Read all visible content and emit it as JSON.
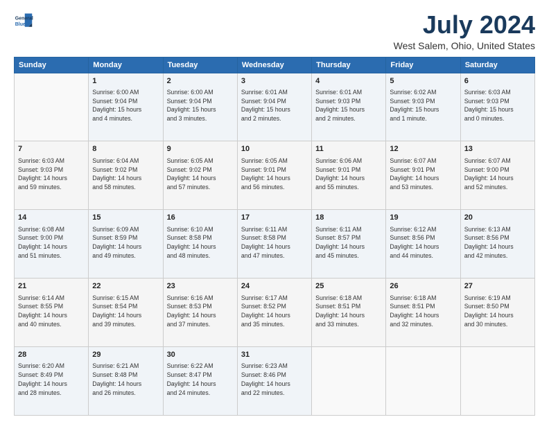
{
  "logo": {
    "line1": "General",
    "line2": "Blue"
  },
  "title": "July 2024",
  "subtitle": "West Salem, Ohio, United States",
  "weekdays": [
    "Sunday",
    "Monday",
    "Tuesday",
    "Wednesday",
    "Thursday",
    "Friday",
    "Saturday"
  ],
  "weeks": [
    [
      {
        "num": "",
        "info": ""
      },
      {
        "num": "1",
        "info": "Sunrise: 6:00 AM\nSunset: 9:04 PM\nDaylight: 15 hours\nand 4 minutes."
      },
      {
        "num": "2",
        "info": "Sunrise: 6:00 AM\nSunset: 9:04 PM\nDaylight: 15 hours\nand 3 minutes."
      },
      {
        "num": "3",
        "info": "Sunrise: 6:01 AM\nSunset: 9:04 PM\nDaylight: 15 hours\nand 2 minutes."
      },
      {
        "num": "4",
        "info": "Sunrise: 6:01 AM\nSunset: 9:03 PM\nDaylight: 15 hours\nand 2 minutes."
      },
      {
        "num": "5",
        "info": "Sunrise: 6:02 AM\nSunset: 9:03 PM\nDaylight: 15 hours\nand 1 minute."
      },
      {
        "num": "6",
        "info": "Sunrise: 6:03 AM\nSunset: 9:03 PM\nDaylight: 15 hours\nand 0 minutes."
      }
    ],
    [
      {
        "num": "7",
        "info": "Sunrise: 6:03 AM\nSunset: 9:03 PM\nDaylight: 14 hours\nand 59 minutes."
      },
      {
        "num": "8",
        "info": "Sunrise: 6:04 AM\nSunset: 9:02 PM\nDaylight: 14 hours\nand 58 minutes."
      },
      {
        "num": "9",
        "info": "Sunrise: 6:05 AM\nSunset: 9:02 PM\nDaylight: 14 hours\nand 57 minutes."
      },
      {
        "num": "10",
        "info": "Sunrise: 6:05 AM\nSunset: 9:01 PM\nDaylight: 14 hours\nand 56 minutes."
      },
      {
        "num": "11",
        "info": "Sunrise: 6:06 AM\nSunset: 9:01 PM\nDaylight: 14 hours\nand 55 minutes."
      },
      {
        "num": "12",
        "info": "Sunrise: 6:07 AM\nSunset: 9:01 PM\nDaylight: 14 hours\nand 53 minutes."
      },
      {
        "num": "13",
        "info": "Sunrise: 6:07 AM\nSunset: 9:00 PM\nDaylight: 14 hours\nand 52 minutes."
      }
    ],
    [
      {
        "num": "14",
        "info": "Sunrise: 6:08 AM\nSunset: 9:00 PM\nDaylight: 14 hours\nand 51 minutes."
      },
      {
        "num": "15",
        "info": "Sunrise: 6:09 AM\nSunset: 8:59 PM\nDaylight: 14 hours\nand 49 minutes."
      },
      {
        "num": "16",
        "info": "Sunrise: 6:10 AM\nSunset: 8:58 PM\nDaylight: 14 hours\nand 48 minutes."
      },
      {
        "num": "17",
        "info": "Sunrise: 6:11 AM\nSunset: 8:58 PM\nDaylight: 14 hours\nand 47 minutes."
      },
      {
        "num": "18",
        "info": "Sunrise: 6:11 AM\nSunset: 8:57 PM\nDaylight: 14 hours\nand 45 minutes."
      },
      {
        "num": "19",
        "info": "Sunrise: 6:12 AM\nSunset: 8:56 PM\nDaylight: 14 hours\nand 44 minutes."
      },
      {
        "num": "20",
        "info": "Sunrise: 6:13 AM\nSunset: 8:56 PM\nDaylight: 14 hours\nand 42 minutes."
      }
    ],
    [
      {
        "num": "21",
        "info": "Sunrise: 6:14 AM\nSunset: 8:55 PM\nDaylight: 14 hours\nand 40 minutes."
      },
      {
        "num": "22",
        "info": "Sunrise: 6:15 AM\nSunset: 8:54 PM\nDaylight: 14 hours\nand 39 minutes."
      },
      {
        "num": "23",
        "info": "Sunrise: 6:16 AM\nSunset: 8:53 PM\nDaylight: 14 hours\nand 37 minutes."
      },
      {
        "num": "24",
        "info": "Sunrise: 6:17 AM\nSunset: 8:52 PM\nDaylight: 14 hours\nand 35 minutes."
      },
      {
        "num": "25",
        "info": "Sunrise: 6:18 AM\nSunset: 8:51 PM\nDaylight: 14 hours\nand 33 minutes."
      },
      {
        "num": "26",
        "info": "Sunrise: 6:18 AM\nSunset: 8:51 PM\nDaylight: 14 hours\nand 32 minutes."
      },
      {
        "num": "27",
        "info": "Sunrise: 6:19 AM\nSunset: 8:50 PM\nDaylight: 14 hours\nand 30 minutes."
      }
    ],
    [
      {
        "num": "28",
        "info": "Sunrise: 6:20 AM\nSunset: 8:49 PM\nDaylight: 14 hours\nand 28 minutes."
      },
      {
        "num": "29",
        "info": "Sunrise: 6:21 AM\nSunset: 8:48 PM\nDaylight: 14 hours\nand 26 minutes."
      },
      {
        "num": "30",
        "info": "Sunrise: 6:22 AM\nSunset: 8:47 PM\nDaylight: 14 hours\nand 24 minutes."
      },
      {
        "num": "31",
        "info": "Sunrise: 6:23 AM\nSunset: 8:46 PM\nDaylight: 14 hours\nand 22 minutes."
      },
      {
        "num": "",
        "info": ""
      },
      {
        "num": "",
        "info": ""
      },
      {
        "num": "",
        "info": ""
      }
    ]
  ],
  "colors": {
    "header_bg": "#2b6cb0",
    "accent": "#1a3a5c"
  }
}
